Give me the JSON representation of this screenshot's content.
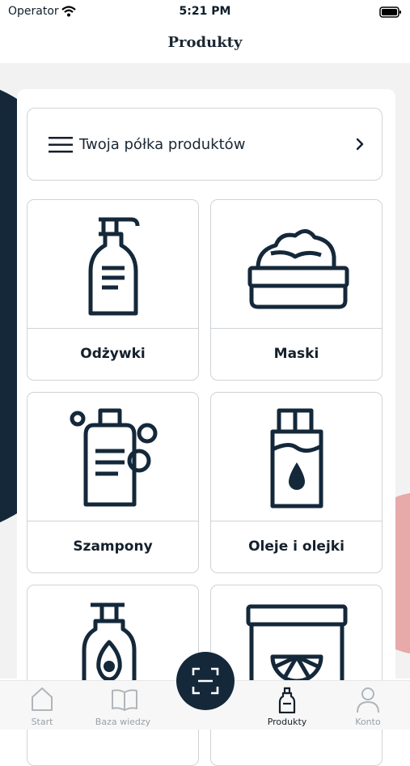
{
  "status": {
    "carrier": "Operator",
    "time": "5:21 PM"
  },
  "header": {
    "title": "Produkty"
  },
  "shelf": {
    "label": "Twoja półka produktów"
  },
  "categories": [
    {
      "label": "Odżywki",
      "icon": "conditioner-bottle-icon"
    },
    {
      "label": "Maski",
      "icon": "mask-jar-icon"
    },
    {
      "label": "Szampony",
      "icon": "shampoo-bottle-icon"
    },
    {
      "label": "Oleje i olejki",
      "icon": "oil-bottle-icon"
    },
    {
      "label": "",
      "icon": "avocado-bottle-icon"
    },
    {
      "label": "",
      "icon": "citrus-jar-icon"
    }
  ],
  "tabbar": {
    "items": [
      {
        "label": "Start",
        "icon": "home-icon"
      },
      {
        "label": "Baza wiedzy",
        "icon": "book-icon"
      },
      {
        "label": "Produkty",
        "icon": "product-bottle-icon",
        "active": true
      },
      {
        "label": "Konto",
        "icon": "user-icon"
      }
    ]
  },
  "colors": {
    "navy": "#14283a",
    "pink": "#e8a9a9",
    "background": "#f2f2f2"
  }
}
